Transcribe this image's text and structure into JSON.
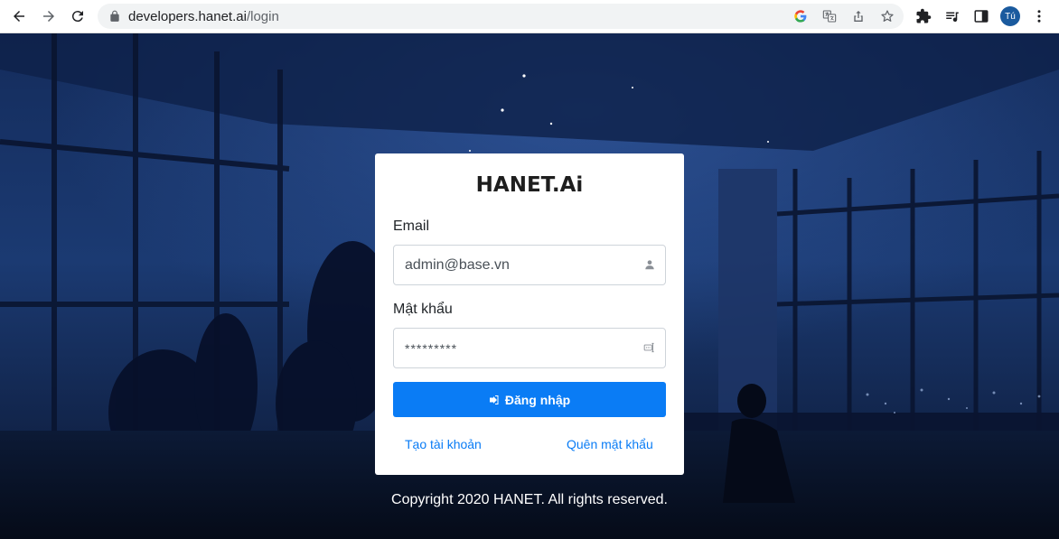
{
  "browser": {
    "url_domain": "developers.hanet.ai",
    "url_path": "/login",
    "profile_initials": "Tú",
    "icons": [
      "back-icon",
      "forward-icon",
      "reload-icon",
      "lock-icon",
      "google-icon",
      "translate-icon",
      "share-icon",
      "bookmark-star-icon",
      "extensions-icon",
      "media-queue-icon",
      "side-panel-icon",
      "menu-dots-icon"
    ]
  },
  "login": {
    "logo": "HANET.Ai",
    "email_label": "Email",
    "email_value": "admin@base.vn",
    "password_label": "Mật khẩu",
    "password_value": "*********",
    "submit_label": "Đăng nhập",
    "create_account_label": "Tạo tài khoản",
    "forgot_password_label": "Quên mật khẩu"
  },
  "footer": {
    "copyright": "Copyright 2020 HANET. All rights reserved."
  },
  "colors": {
    "accent": "#0a7cf5",
    "background": "#0d1a33",
    "card": "#ffffff"
  }
}
